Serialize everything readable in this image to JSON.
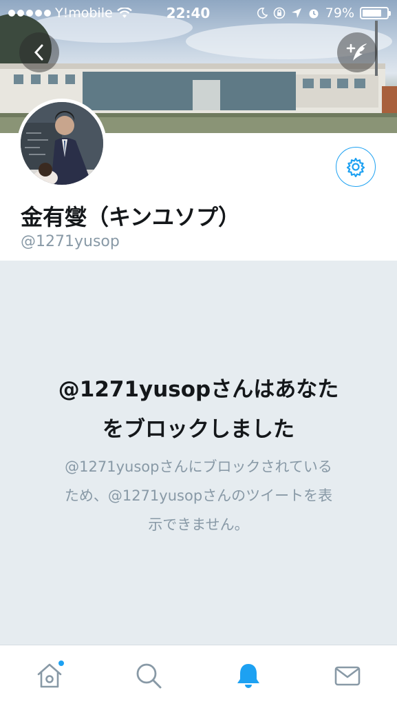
{
  "status_bar": {
    "carrier": "Y!mobile",
    "time": "22:40",
    "battery_percent": "79%",
    "battery_level": 0.79
  },
  "profile": {
    "display_name": "金有燮（キンユソプ）",
    "handle": "@1271yusop"
  },
  "blocked": {
    "title_line1": "@1271yusopさんはあなた",
    "title_line2": "をブロックしました",
    "desc_line1": "@1271yusopさんにブロックされている",
    "desc_line2": "ため、@1271yusopさんのツイートを表",
    "desc_line3": "示できません。"
  },
  "tabs": [
    {
      "name": "home",
      "icon": "home-icon",
      "active": false,
      "has_notification_dot": true
    },
    {
      "name": "search",
      "icon": "search-icon",
      "active": false
    },
    {
      "name": "notifications",
      "icon": "bell-icon",
      "active": true
    },
    {
      "name": "messages",
      "icon": "mail-icon",
      "active": false
    }
  ],
  "colors": {
    "accent": "#1da1f2",
    "text_primary": "#14171a",
    "text_secondary": "#8899a6",
    "blocked_bg": "#e6ecf0"
  }
}
